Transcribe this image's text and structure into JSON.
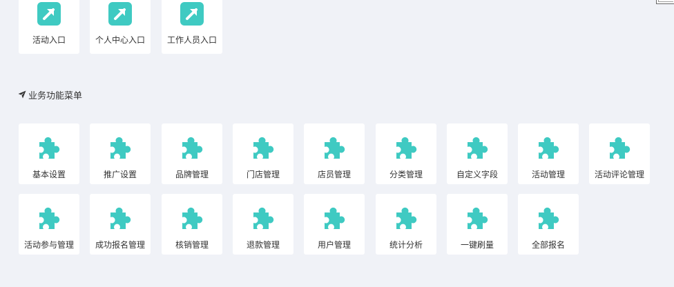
{
  "accent_color": "#3fcac2",
  "entry_links": [
    {
      "label": "活动入口",
      "icon": "external-link-icon"
    },
    {
      "label": "个人中心入口",
      "icon": "external-link-icon"
    },
    {
      "label": "工作人员入口",
      "icon": "external-link-icon"
    }
  ],
  "business_section": {
    "title": "业务功能菜单",
    "icon": "airplane-icon"
  },
  "menu_items": [
    {
      "label": "基本设置",
      "icon": "puzzle-icon"
    },
    {
      "label": "推广设置",
      "icon": "puzzle-icon"
    },
    {
      "label": "品牌管理",
      "icon": "puzzle-icon"
    },
    {
      "label": "门店管理",
      "icon": "puzzle-icon"
    },
    {
      "label": "店员管理",
      "icon": "puzzle-icon"
    },
    {
      "label": "分类管理",
      "icon": "puzzle-icon"
    },
    {
      "label": "自定义字段",
      "icon": "puzzle-icon"
    },
    {
      "label": "活动管理",
      "icon": "puzzle-icon"
    },
    {
      "label": "活动评论管理",
      "icon": "puzzle-icon"
    },
    {
      "label": "活动参与管理",
      "icon": "puzzle-icon"
    },
    {
      "label": "成功报名管理",
      "icon": "puzzle-icon"
    },
    {
      "label": "核销管理",
      "icon": "puzzle-icon"
    },
    {
      "label": "退款管理",
      "icon": "puzzle-icon"
    },
    {
      "label": "用户管理",
      "icon": "puzzle-icon"
    },
    {
      "label": "统计分析",
      "icon": "puzzle-icon"
    },
    {
      "label": "一键刷量",
      "icon": "puzzle-icon"
    },
    {
      "label": "全部报名",
      "icon": "puzzle-icon"
    }
  ]
}
